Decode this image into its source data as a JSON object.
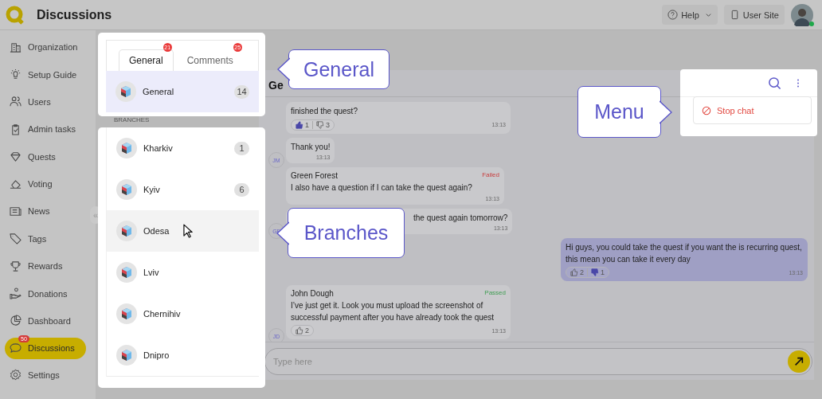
{
  "header": {
    "title": "Discussions",
    "help": "Help",
    "user_site": "User Site",
    "online": true
  },
  "sidebar": {
    "items": [
      {
        "label": "Organization",
        "selected": false
      },
      {
        "label": "Setup Guide",
        "selected": false
      },
      {
        "label": "Users",
        "selected": false
      },
      {
        "label": "Admin tasks",
        "selected": false
      },
      {
        "label": "Quests",
        "selected": false
      },
      {
        "label": "Voting",
        "selected": false
      },
      {
        "label": "News",
        "selected": false
      },
      {
        "label": "Tags",
        "selected": false
      },
      {
        "label": "Rewards",
        "selected": false
      },
      {
        "label": "Donations",
        "selected": false
      },
      {
        "label": "Dashboard",
        "selected": false
      },
      {
        "label": "Discussions",
        "selected": true,
        "badge": "50"
      }
    ],
    "footer_item": {
      "label": "Settings"
    },
    "collapse": "«"
  },
  "tabs": [
    {
      "label": "General",
      "badge": "21",
      "selected": true
    },
    {
      "label": "Comments",
      "badge": "25",
      "selected": false
    }
  ],
  "general_chat": {
    "name": "General",
    "count": "14",
    "selected": true
  },
  "branches": {
    "heading": "BRANCHES",
    "items": [
      {
        "name": "Kharkiv",
        "count": "1",
        "hovered": false
      },
      {
        "name": "Kyiv",
        "count": "6",
        "hovered": false
      },
      {
        "name": "Odesa",
        "hovered": true
      },
      {
        "name": "Lviv",
        "hovered": false
      },
      {
        "name": "Chernihiv",
        "hovered": false
      },
      {
        "name": "Dnipro",
        "hovered": false
      }
    ]
  },
  "chat": {
    "title": "Ge",
    "messages": [
      {
        "kind": "incoming",
        "text": "finished the quest?",
        "likes": {
          "count": "1",
          "active": true
        },
        "dislikes": {
          "count": "3",
          "active": false
        },
        "time": "13:13"
      },
      {
        "kind": "incoming",
        "avatar": "JM",
        "text": "Thank you!",
        "time": "13:13"
      },
      {
        "kind": "incoming",
        "author": "Green Forest",
        "status": {
          "label": "Failed",
          "kind": "failed"
        },
        "text": "I also have a question if I can take the quest again?",
        "time": "13:13"
      },
      {
        "kind": "incoming",
        "avatar": "GF",
        "text": "the quest again tomorrow?",
        "time": "13:13"
      },
      {
        "kind": "outgoing",
        "text": "Hi guys, you could take the quest if you want the is recurring quest, this mean you can take it every day",
        "likes": {
          "count": "2",
          "active": false
        },
        "dislikes": {
          "count": "1",
          "active": true
        },
        "time": "13:13"
      },
      {
        "kind": "incoming",
        "avatar": "JD",
        "author": "John Dough",
        "status": {
          "label": "Passed",
          "kind": "passed"
        },
        "text": "I’ve just get it. Look you must upload the screenshot of successful payment after you have already took the quest",
        "likes": {
          "count": "2",
          "active": false
        },
        "time": "13:13"
      }
    ],
    "input": {
      "placeholder": "Type here"
    }
  },
  "menu": {
    "items": [
      {
        "label": "Stop chat"
      }
    ]
  },
  "callouts": [
    {
      "text": "General",
      "kind": "general"
    },
    {
      "text": "Branches",
      "kind": "branches"
    },
    {
      "text": "Menu",
      "kind": "menu"
    }
  ]
}
